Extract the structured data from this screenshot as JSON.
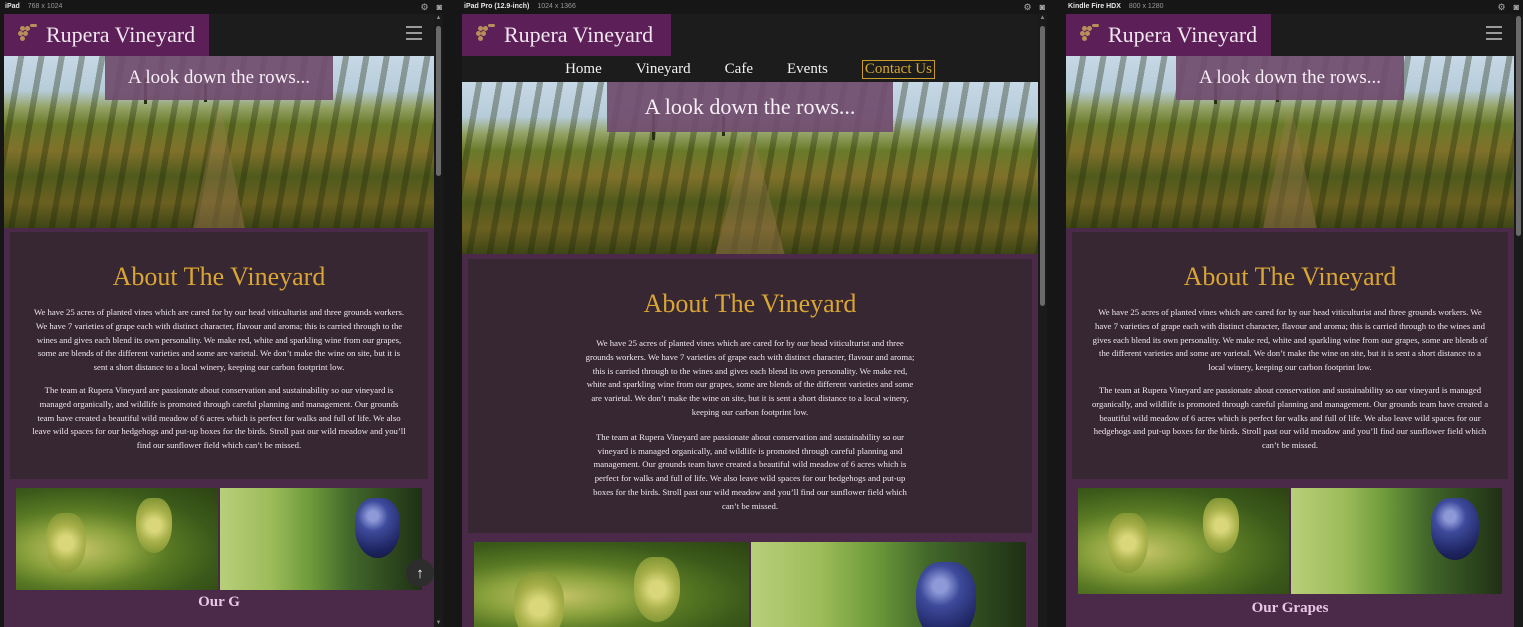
{
  "devices": [
    {
      "name": "iPad",
      "size": "768 x 1024"
    },
    {
      "name": "iPad Pro (12.9-inch)",
      "size": "1024 x 1366"
    },
    {
      "name": "Kindle Fire HDX",
      "size": "800 x 1280"
    }
  ],
  "site": {
    "brand": "Rupera Vineyard",
    "nav": [
      "Home",
      "Vineyard",
      "Cafe",
      "Events",
      "Contact Us"
    ],
    "hero_title": "A look down the rows...",
    "about_title": "About The Vineyard",
    "about_p1": "We have 25 acres of planted vines which are cared for by our head viticulturist and three grounds workers. We have 7 varieties of grape each with distinct character, flavour and aroma; this is carried through to the wines and gives each blend its own personality. We make red, white and sparkling wine from our grapes, some are blends of the different varieties and some are varietal. We don’t make the wine on site, but it is sent a short distance to a local winery, keeping our carbon footprint low.",
    "about_p2": "The team at Rupera Vineyard are passionate about conservation and sustainability so our vineyard is managed organically, and wildlife is promoted through careful planning and management. Our grounds team have created a beautiful wild meadow of 6 acres which is perfect for walks and full of life. We also leave wild spaces for our hedgehogs and put-up boxes for the birds. Stroll past our wild meadow and you’ll find our sunflower field which can’t be missed.",
    "grapes_title": "Our Grapes",
    "grapes_title_partial": "Our G",
    "scroll_top_icon": "↑"
  },
  "icons": [
    "settings-icon",
    "screenshot-icon",
    "hamburger-menu-icon",
    "logo-grapes-icon",
    "arrow-up-icon"
  ],
  "colors": {
    "brand_purple": "#5c1f58",
    "gold": "#d9a533",
    "panel": "#362733",
    "frame": "#4a2a48"
  }
}
